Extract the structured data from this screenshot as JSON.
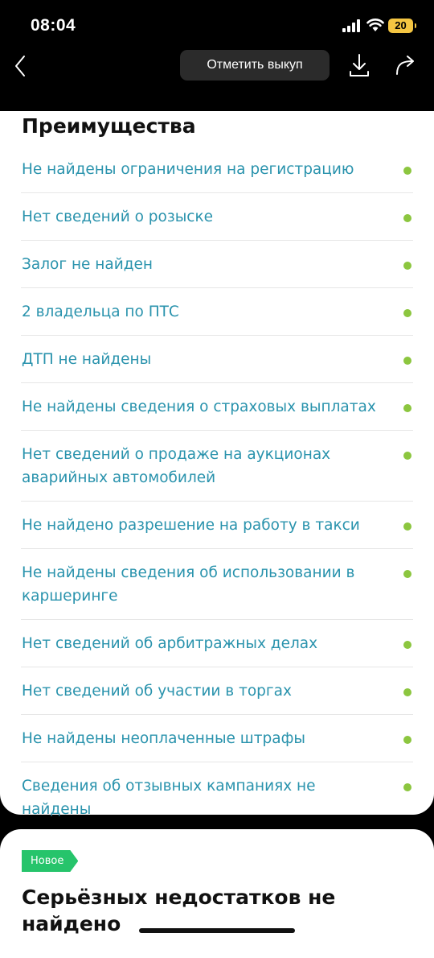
{
  "status_bar": {
    "time": "08:04",
    "battery": "20"
  },
  "nav": {
    "mark_button": "Отметить выкуп"
  },
  "colors": {
    "accent_text": "#2a93ad",
    "dot": "#8cc63f",
    "badge": "#26c46b",
    "battery": "#f4c542"
  },
  "advantages": {
    "title": "Преимущества",
    "items": [
      {
        "label": "Не найдены ограничения на регистрацию"
      },
      {
        "label": "Нет сведений о розыске"
      },
      {
        "label": "Залог не найден"
      },
      {
        "label": "2 владельца по ПТС"
      },
      {
        "label": "ДТП не найдены"
      },
      {
        "label": "Не найдены сведения о страховых выплатах"
      },
      {
        "label": "Нет сведений о продаже на аукционах аварийных автомобилей"
      },
      {
        "label": "Не найдено разрешение на работу в такси"
      },
      {
        "label": "Не найдены сведения об использовании в каршеринге"
      },
      {
        "label": "Нет сведений об арбитражных делах"
      },
      {
        "label": "Нет сведений об участии в торгах"
      },
      {
        "label": "Не найдены неоплаченные штрафы"
      },
      {
        "label": "Сведения об отзывных кампаниях не найдены"
      }
    ]
  },
  "shortcomings": {
    "badge": "Новое",
    "title": "Серьёзных недостатков не найдено"
  }
}
